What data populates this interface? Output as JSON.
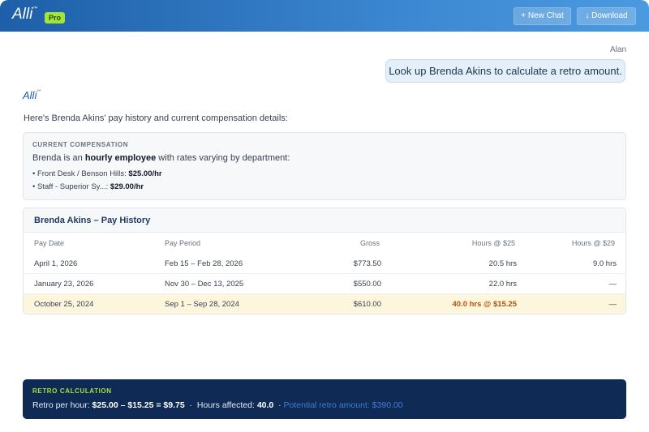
{
  "header": {
    "logo": "Alli",
    "logo_mark": "™",
    "badge": "Pro",
    "new_chat_label": "New Chat",
    "new_chat_icon": "+",
    "download_label": "Download",
    "download_icon": "↓"
  },
  "conversation": {
    "user_name": "Alan",
    "user_message": "Look up Brenda Akins to calculate a retro amount.",
    "assistant_name": "Alli",
    "assistant_mark": "™",
    "intro": "Here's Brenda Akins' pay history and current compensation details:"
  },
  "compensation": {
    "title": "CURRENT COMPENSATION",
    "desc_pre": "Brenda is an ",
    "desc_bold": "hourly employee",
    "desc_post": " with rates varying by department:",
    "rates": [
      {
        "label": "• Front Desk / Benson Hills: ",
        "value": "$25.00/hr"
      },
      {
        "label": "• Staff - Superior Sy...: ",
        "value": "$29.00/hr"
      }
    ]
  },
  "history": {
    "title": "Brenda Akins – Pay History",
    "columns": [
      "Pay Date",
      "Pay Period",
      "Gross",
      "Hours @ $25",
      "Hours @ $29"
    ],
    "rows": [
      {
        "date": "April 1, 2026",
        "period": "Feb 15 – Feb 28, 2026",
        "gross": "$773.50",
        "h25": "20.5 hrs",
        "h29": "9.0 hrs"
      },
      {
        "date": "January 23, 2026",
        "period": "Nov 30 – Dec 13, 2025",
        "gross": "$550.00",
        "h25": "22.0 hrs",
        "h29": "—"
      },
      {
        "date": "October 25, 2024",
        "period": "Sep 1 – Sep 28, 2024",
        "gross": "$610.00",
        "h25": "40.0 hrs @ $15.25",
        "h29": "—"
      }
    ]
  },
  "retro": {
    "title": "RETRO CALCULATION",
    "per_hour_label": "Retro per hour: ",
    "per_hour_value": "$25.00 – $15.25 = $9.75",
    "sep1": "·",
    "hours_label": "Hours affected: ",
    "hours_value": "40.0",
    "sep2": "·",
    "potential": "Potential retro amount: $390.00"
  },
  "colors": {
    "header_start": "#1d5fa8",
    "badge": "#a3e635",
    "retro_bg": "#0e2a55",
    "highlight_row": "#fdf6dd",
    "highlight_text": "#b45309"
  }
}
